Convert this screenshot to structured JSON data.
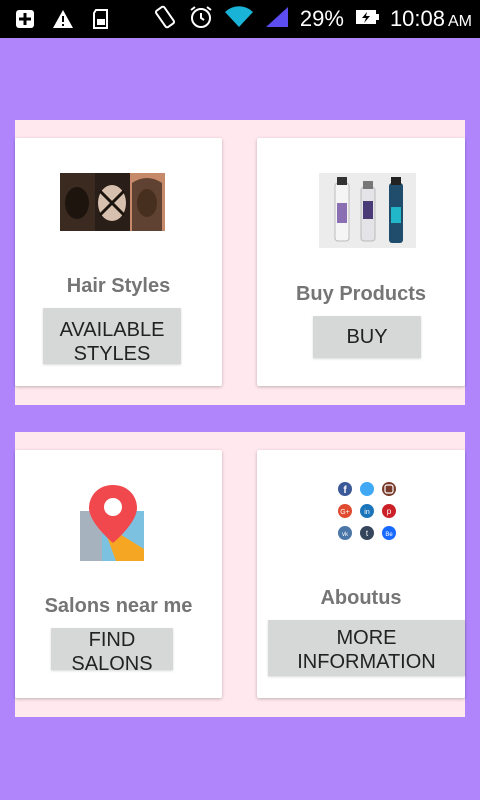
{
  "status_bar": {
    "left_icons": [
      "add-box-icon",
      "warning-icon",
      "sd-card-icon"
    ],
    "battery_percent": "29%",
    "time": "10:08",
    "ampm": "AM"
  },
  "cards": {
    "hair_styles": {
      "title": "Hair Styles",
      "button": "AVAILABLE STYLES",
      "image": "hair-styles-photo"
    },
    "buy_products": {
      "title": "Buy Products",
      "button": "BUY",
      "image": "hair-products-photo"
    },
    "salons": {
      "title": "Salons near me",
      "button": "FIND SALONS",
      "image": "map-pin-icon"
    },
    "about": {
      "title": "Aboutus",
      "button": "MORE INFORMATION",
      "image": "social-icons-grid"
    }
  },
  "colors": {
    "background": "#b085fb",
    "panel": "#ffe8ee",
    "button": "#d6d7d7",
    "title_text": "#757575"
  }
}
